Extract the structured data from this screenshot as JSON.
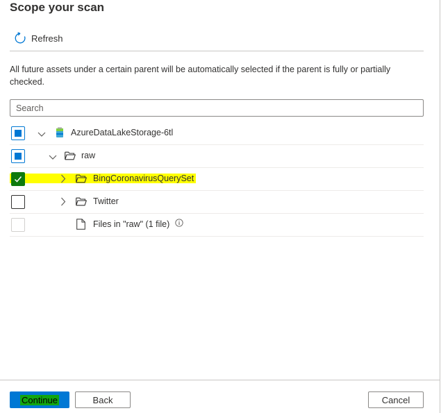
{
  "title": "Scope your scan",
  "toolbar": {
    "refresh_label": "Refresh",
    "refresh_icon": "refresh-icon"
  },
  "description": "All future assets under a certain parent will be automatically selected if the parent is fully or partially checked.",
  "search": {
    "placeholder": "Search",
    "value": ""
  },
  "tree": [
    {
      "label": "AzureDataLakeStorage-6tl",
      "level": 0,
      "state": "partial",
      "expanded": true,
      "icon": "storage-account-icon"
    },
    {
      "label": "raw",
      "level": 1,
      "state": "partial",
      "expanded": true,
      "icon": "folder-icon"
    },
    {
      "label": "BingCoronavirusQuerySet",
      "level": 2,
      "state": "checked",
      "expanded": false,
      "icon": "folder-icon",
      "highlighted": true
    },
    {
      "label": "Twitter",
      "level": 2,
      "state": "unchecked",
      "expanded": false,
      "icon": "folder-icon"
    },
    {
      "label": "Files in \"raw\" (1 file)",
      "level": 2,
      "state": "disabled",
      "icon": "file-icon",
      "info": true
    }
  ],
  "footer": {
    "continue_label": "Continue",
    "back_label": "Back",
    "cancel_label": "Cancel"
  },
  "colors": {
    "accent": "#0078d4",
    "checked": "#0e7a0d",
    "highlight": "#ffff00"
  }
}
